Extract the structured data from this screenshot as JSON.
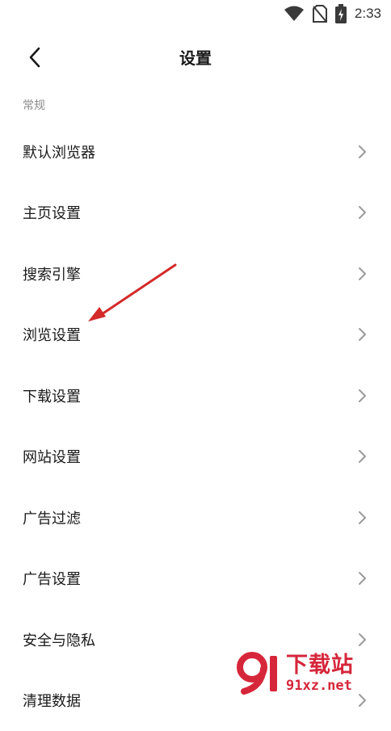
{
  "status_bar": {
    "time": "2:33",
    "icons": [
      "wifi-icon",
      "no-sim-icon",
      "battery-charging-icon"
    ]
  },
  "header": {
    "title": "设置",
    "back_icon": "chevron-left-icon"
  },
  "section": {
    "label": "常规"
  },
  "settings": {
    "items": [
      {
        "label": "默认浏览器"
      },
      {
        "label": "主页设置"
      },
      {
        "label": "搜索引擎"
      },
      {
        "label": "浏览设置"
      },
      {
        "label": "下载设置"
      },
      {
        "label": "网站设置"
      },
      {
        "label": "广告过滤"
      },
      {
        "label": "广告设置"
      },
      {
        "label": "安全与隐私"
      },
      {
        "label": "清理数据"
      }
    ]
  },
  "annotation": {
    "color": "#d42a2a",
    "points_to": "浏览设置"
  },
  "watermark": {
    "title": "下载站",
    "url": "91xz.net",
    "color": "#d6263a"
  }
}
